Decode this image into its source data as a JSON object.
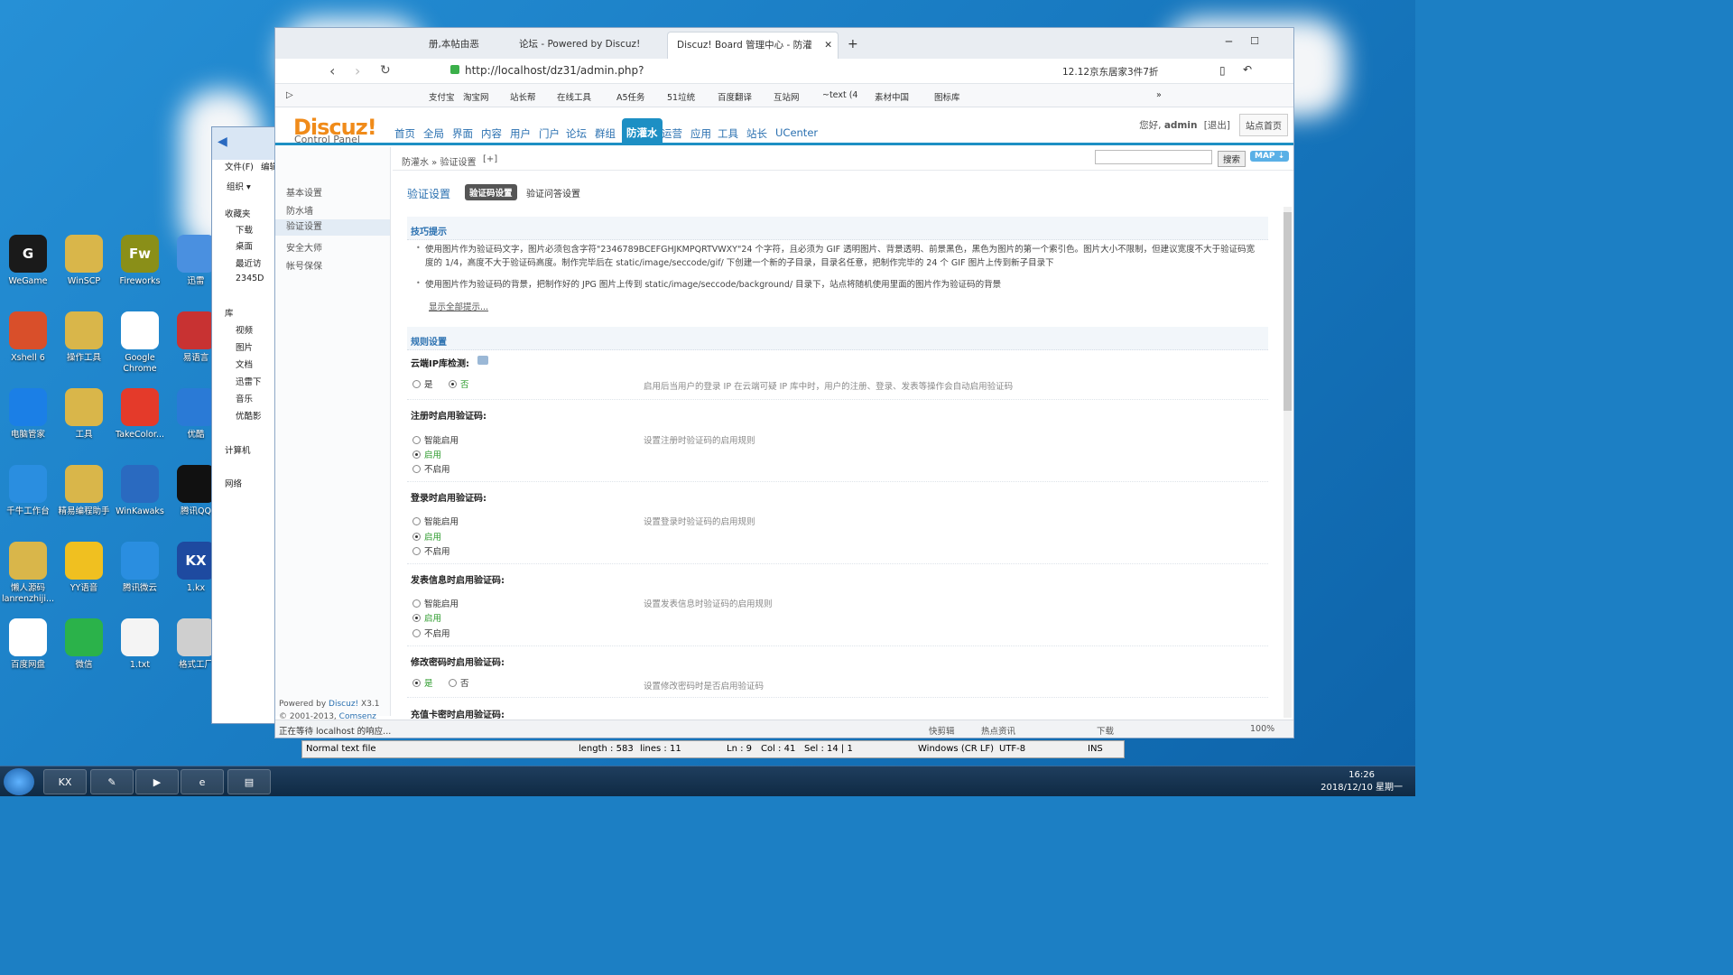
{
  "desktop": {
    "icons": [
      {
        "label": "WeGame",
        "color": "#1a1a1a",
        "glyph": "G"
      },
      {
        "label": "WinSCP",
        "color": "#d9b64a",
        "glyph": ""
      },
      {
        "label": "Fireworks",
        "color": "#8a8f18",
        "glyph": "Fw"
      },
      {
        "label": "迅雷",
        "color": "#4a90e0",
        "glyph": ""
      },
      {
        "label": "Xshell 6",
        "color": "#d94f2a",
        "glyph": ""
      },
      {
        "label": "操作工具",
        "color": "#d9b64a",
        "glyph": ""
      },
      {
        "label": "Google Chrome",
        "color": "#ffffff",
        "glyph": ""
      },
      {
        "label": "易语言",
        "color": "#c83232",
        "glyph": ""
      },
      {
        "label": "电脑管家",
        "color": "#1b7fe6",
        "glyph": ""
      },
      {
        "label": "工具",
        "color": "#d9b64a",
        "glyph": ""
      },
      {
        "label": "TakeColor...",
        "color": "#e43a2a",
        "glyph": ""
      },
      {
        "label": "优酷",
        "color": "#2a7ad6",
        "glyph": ""
      },
      {
        "label": "千牛工作台",
        "color": "#2a8ee0",
        "glyph": ""
      },
      {
        "label": "精易编程助手",
        "color": "#d9b64a",
        "glyph": ""
      },
      {
        "label": "WinKawaks",
        "color": "#2a6ac0",
        "glyph": ""
      },
      {
        "label": "腾讯QQ",
        "color": "#111111",
        "glyph": ""
      },
      {
        "label": "懒人源码 lanrenzhiji...",
        "color": "#d9b64a",
        "glyph": ""
      },
      {
        "label": "YY语音",
        "color": "#f0c020",
        "glyph": ""
      },
      {
        "label": "腾讯微云",
        "color": "#2a8ee0",
        "glyph": ""
      },
      {
        "label": "1.kx",
        "color": "#1e4aa0",
        "glyph": "KX"
      },
      {
        "label": "百度网盘",
        "color": "#ffffff",
        "glyph": ""
      },
      {
        "label": "微信",
        "color": "#2bb24a",
        "glyph": ""
      },
      {
        "label": "1.txt",
        "color": "#f4f4f4",
        "glyph": ""
      },
      {
        "label": "格式工厂",
        "color": "#cfcfcf",
        "glyph": ""
      }
    ]
  },
  "explorer": {
    "menu_file": "文件(F)",
    "menu_edit": "编辑",
    "organize": "组织 ▾",
    "items": [
      "收藏夹",
      "下载",
      "桌面",
      "最近访",
      "2345D",
      "库",
      "视频",
      "图片",
      "文档",
      "迅雷下",
      "音乐",
      "优酷影",
      "计算机",
      "网络"
    ]
  },
  "browser": {
    "tabs": [
      "册,本帖由恶",
      "论坛 - Powered by Discuz!",
      "Discuz! Board 管理中心 - 防灌"
    ],
    "new_tab": "+",
    "url": "http://localhost/dz31/admin.php?",
    "promo": "12.12京东居家3件7折",
    "bookmarks": [
      "支付宝",
      "淘宝网",
      "站长帮",
      "在线工具",
      "A5任务",
      "51垃统",
      "百度翻译",
      "互站网",
      "~text (4",
      "素材中国",
      "图标库"
    ],
    "more": "»",
    "status": "正在等待 localhost 的响应...",
    "status_items": [
      "快剪辑",
      "热点资讯",
      "下载",
      "100%"
    ]
  },
  "discuz": {
    "logo": "Discuz!",
    "logo_sub": "Control Panel",
    "nav": [
      "首页",
      "全局",
      "界面",
      "内容",
      "用户",
      "门户",
      "论坛",
      "群组",
      "防灌水",
      "运营",
      "应用",
      "工具",
      "站长",
      "UCenter"
    ],
    "user_greeting": "您好,",
    "user_name": "admin",
    "logout": "[退出]",
    "site_home": "站点首页",
    "search_button": "搜索",
    "map_button": "MAP ⇣",
    "breadcrumb": "防灌水 » 验证设置",
    "breadcrumb_add": "[+]",
    "sidebar": [
      "基本设置",
      "防水墙",
      "验证设置",
      "安全大师",
      "帐号保保"
    ],
    "footer_powered": "Powered by",
    "footer_brand": "Discuz!",
    "footer_ver": "X3.1",
    "footer_copy": "© 2001-2013,",
    "footer_company": "Comsenz Inc.",
    "page_title": "验证设置",
    "subtab_active": "验证码设置",
    "subtab_other": "验证问答设置",
    "tips_title": "技巧提示",
    "tip1": "使用图片作为验证码文字，图片必须包含字符\"2346789BCEFGHJKMPQRTVWXY\"24 个字符，且必须为 GIF 透明图片、背景透明、前景黑色，黑色为图片的第一个索引色。图片大小不限制，但建议宽度不大于验证码宽度的 1/4，高度不大于验证码高度。制作完毕后在 static/image/seccode/gif/ 下创建一个新的子目录，目录名任意，把制作完毕的 24 个 GIF 图片上传到新子目录下",
    "tip2": "使用图片作为验证码的背景，把制作好的 JPG 图片上传到 static/image/seccode/background/ 目录下，站点将随机使用里面的图片作为验证码的背景",
    "show_all_tips": "显示全部提示...",
    "rules_title": "规则设置",
    "cloud_ip_label": "云端IP库检测:",
    "yes": "是",
    "no": "否",
    "cloud_ip_desc": "启用后当用户的登录 IP 在云端可疑 IP 库中时，用户的注册、登录、发表等操作会自动启用验证码",
    "smart": "智能启用",
    "enable": "启用",
    "disable": "不启用",
    "reg_label": "注册时启用验证码:",
    "reg_desc": "设置注册时验证码的启用规则",
    "login_label": "登录时启用验证码:",
    "login_desc": "设置登录时验证码的启用规则",
    "post_label": "发表信息时启用验证码:",
    "post_desc": "设置发表信息时验证码的启用规则",
    "pwd_label": "修改密码时启用验证码:",
    "pwd_desc": "设置修改密码时是否启用验证码",
    "recharge_label": "充值卡密时启用验证码:"
  },
  "notepad": {
    "type": "Normal text file",
    "length": "length : 583",
    "lines": "lines : 11",
    "ln": "Ln : 9",
    "col": "Col : 41",
    "sel": "Sel : 14 | 1",
    "eol": "Windows (CR LF)",
    "enc": "UTF-8",
    "ins": "INS"
  },
  "taskbar": {
    "time": "16:26",
    "date": "2018/12/10 星期一"
  }
}
